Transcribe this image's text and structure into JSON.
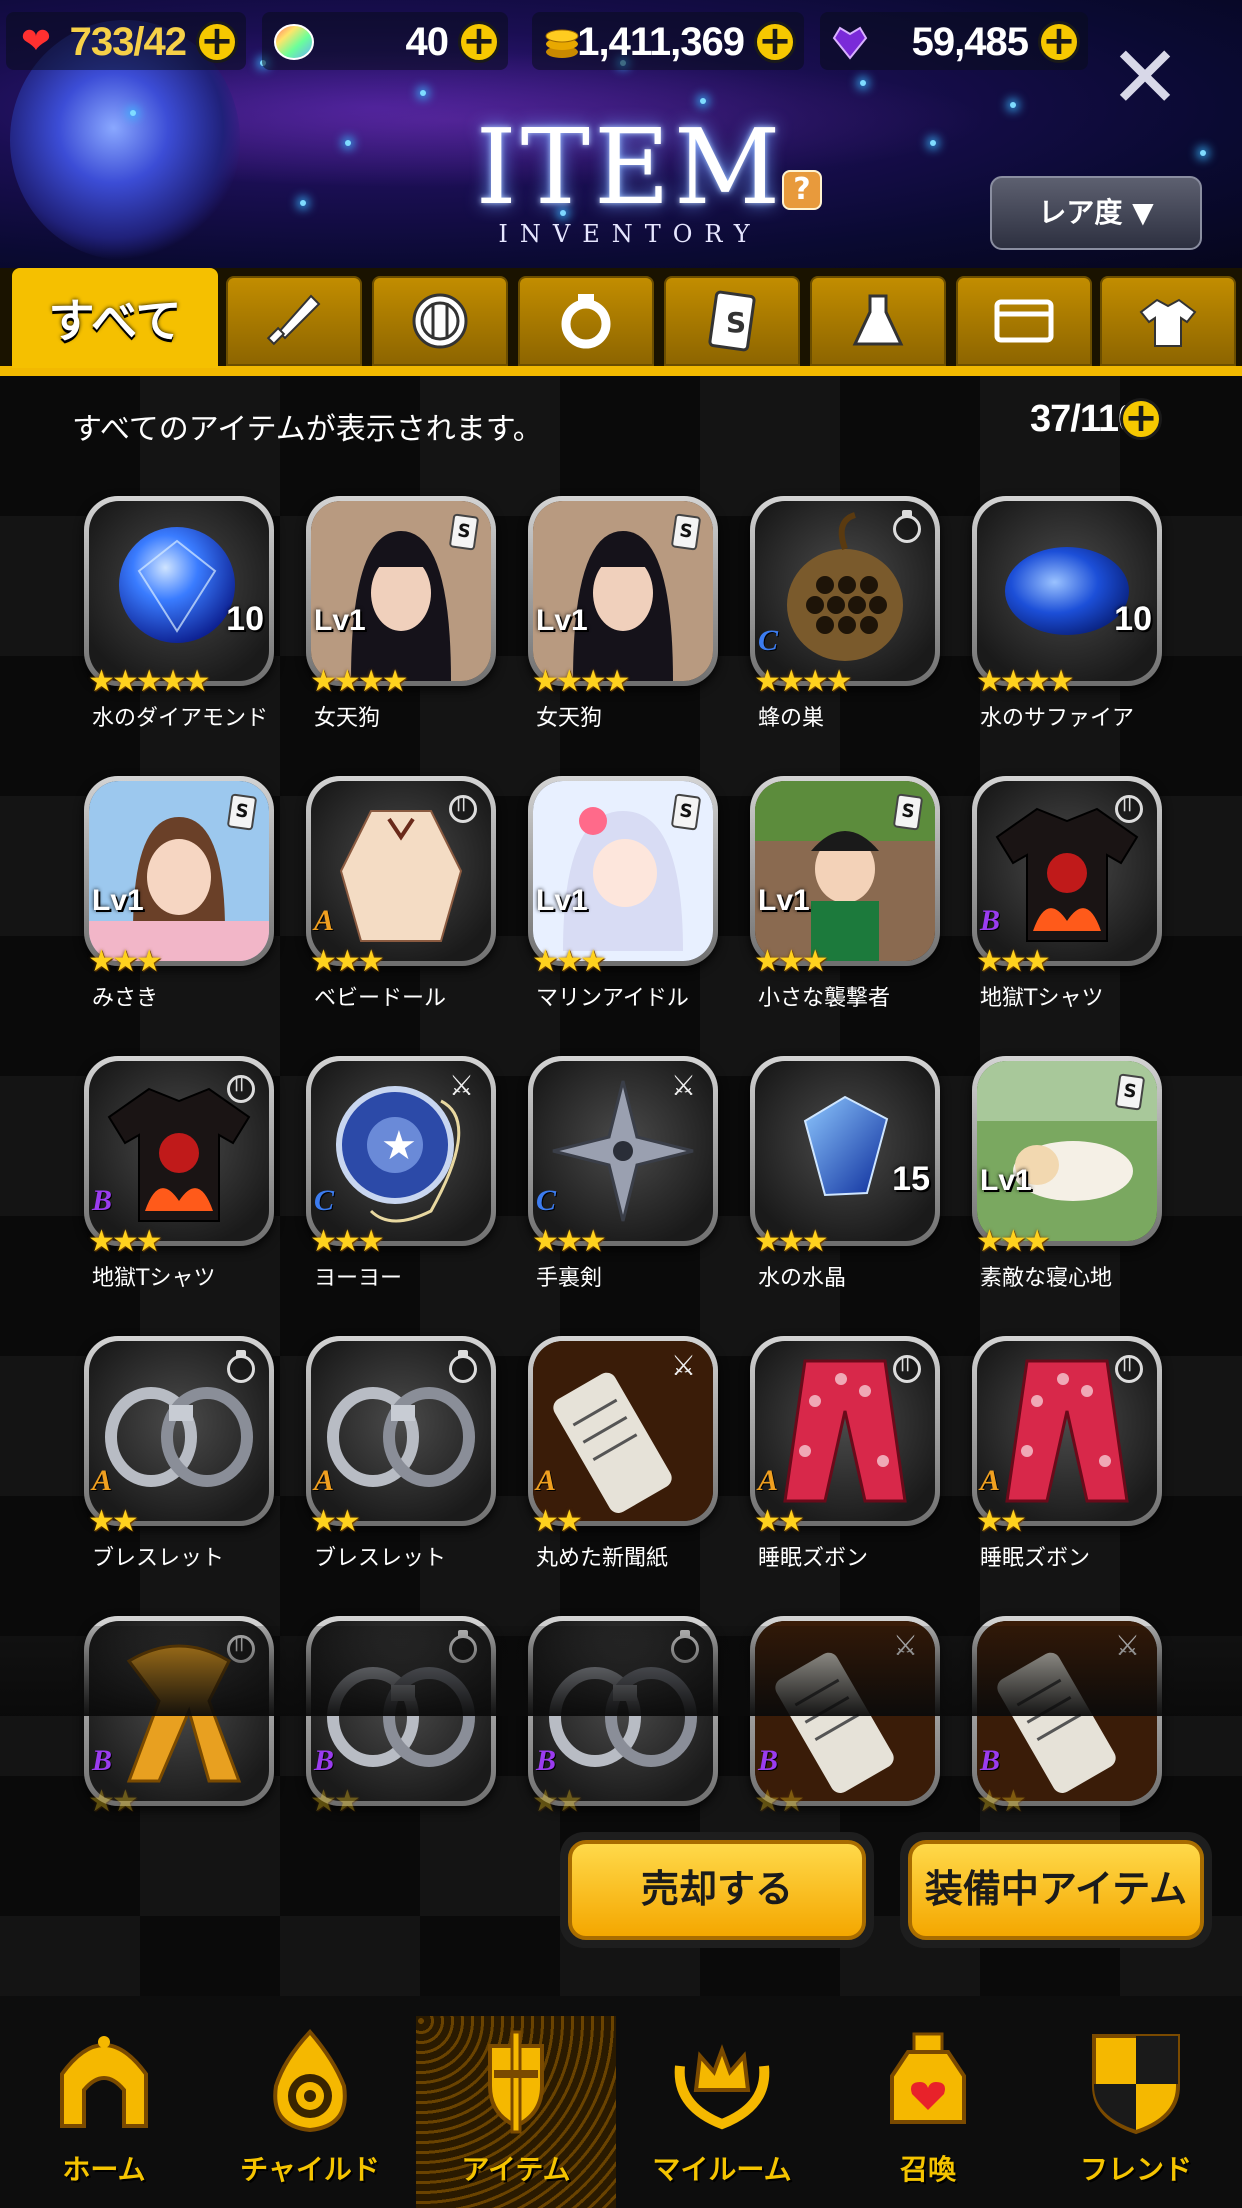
{
  "header": {
    "title": "ITEM",
    "subtitle": "INVENTORY",
    "help_label": "?",
    "sort_label": "レア度 ▼",
    "close_label": "✕",
    "resources": [
      {
        "name": "stamina",
        "icon": "heart-icon",
        "value": "733/42"
      },
      {
        "name": "gem-rainbow",
        "icon": "rainbow-gem-icon",
        "value": "40"
      },
      {
        "name": "gold",
        "icon": "gold-coin-icon",
        "value": "1,411,369"
      },
      {
        "name": "heart-gem",
        "icon": "purple-heart-gem-icon",
        "value": "59,485"
      }
    ]
  },
  "tabs": [
    {
      "label": "すべて",
      "icon": null
    },
    {
      "icon": "knife-icon"
    },
    {
      "icon": "shield-icon"
    },
    {
      "icon": "ring-icon"
    },
    {
      "icon": "card-icon"
    },
    {
      "icon": "flask-icon"
    },
    {
      "icon": "wallet-icon"
    },
    {
      "icon": "shirt-icon"
    }
  ],
  "content": {
    "info_text": "すべてのアイテムが表示されます。",
    "capacity": "37/110",
    "items": [
      {
        "name": "水のダイアモンド",
        "stars": "★★★★★",
        "stack": "10",
        "art": "blue-diamond",
        "badge": null,
        "lvl": null,
        "rank": null
      },
      {
        "name": "女天狗",
        "stars": "★★★★",
        "stack": null,
        "art": "portrait-dark",
        "badge": "card",
        "lvl": "Lv1",
        "rank": null
      },
      {
        "name": "女天狗",
        "stars": "★★★★",
        "stack": null,
        "art": "portrait-dark",
        "badge": "card",
        "lvl": "Lv1",
        "rank": null
      },
      {
        "name": "蜂の巣",
        "stars": "★★★★",
        "stack": null,
        "art": "beehive",
        "badge": "ring",
        "lvl": null,
        "rank": "C"
      },
      {
        "name": "水のサファイア",
        "stars": "★★★★",
        "stack": "10",
        "art": "sapphire",
        "badge": null,
        "lvl": null,
        "rank": null
      },
      {
        "name": "みさき",
        "stars": "★★★",
        "stack": null,
        "art": "portrait-light",
        "badge": "card",
        "lvl": "Lv1",
        "rank": null
      },
      {
        "name": "ベビードール",
        "stars": "★★★",
        "stack": null,
        "art": "babydoll",
        "badge": "cloth",
        "lvl": null,
        "rank": "A"
      },
      {
        "name": "マリンアイドル",
        "stars": "★★★",
        "stack": null,
        "art": "anime-idol",
        "badge": "card",
        "lvl": "Lv1",
        "rank": null
      },
      {
        "name": "小さな襲撃者",
        "stars": "★★★",
        "stack": null,
        "art": "boy-raider",
        "badge": "card",
        "lvl": "Lv1",
        "rank": null
      },
      {
        "name": "地獄Tシャツ",
        "stars": "★★★",
        "stack": null,
        "art": "hell-shirt",
        "badge": "cloth",
        "lvl": null,
        "rank": "B"
      },
      {
        "name": "地獄Tシャツ",
        "stars": "★★★",
        "stack": null,
        "art": "hell-shirt",
        "badge": "cloth",
        "lvl": null,
        "rank": "B"
      },
      {
        "name": "ヨーヨー",
        "stars": "★★★",
        "stack": null,
        "art": "yoyo",
        "badge": "knife",
        "lvl": null,
        "rank": "C"
      },
      {
        "name": "手裏剣",
        "stars": "★★★",
        "stack": null,
        "art": "shuriken",
        "badge": "knife",
        "lvl": null,
        "rank": "C"
      },
      {
        "name": "水の水晶",
        "stars": "★★★",
        "stack": "15",
        "art": "crystal",
        "badge": null,
        "lvl": null,
        "rank": null
      },
      {
        "name": "素敵な寝心地",
        "stars": "★★★",
        "stack": null,
        "art": "sleeping",
        "badge": "card",
        "lvl": "Lv1",
        "rank": null
      },
      {
        "name": "ブレスレット",
        "stars": "★★",
        "stack": null,
        "art": "cuffs",
        "badge": "ring",
        "lvl": null,
        "rank": "A"
      },
      {
        "name": "ブレスレット",
        "stars": "★★",
        "stack": null,
        "art": "cuffs",
        "badge": "ring",
        "lvl": null,
        "rank": "A"
      },
      {
        "name": "丸めた新聞紙",
        "stars": "★★",
        "stack": null,
        "art": "newspaper",
        "badge": "knife",
        "lvl": null,
        "rank": "A"
      },
      {
        "name": "睡眠ズボン",
        "stars": "★★",
        "stack": null,
        "art": "pants",
        "badge": "cloth",
        "lvl": null,
        "rank": "A"
      },
      {
        "name": "睡眠ズボン",
        "stars": "★★",
        "stack": null,
        "art": "pants",
        "badge": "cloth",
        "lvl": null,
        "rank": "A"
      },
      {
        "name": "",
        "stars": "★★",
        "stack": null,
        "art": "scarf",
        "badge": "cloth",
        "lvl": null,
        "rank": "B"
      },
      {
        "name": "",
        "stars": "★★",
        "stack": null,
        "art": "cuffs",
        "badge": "ring",
        "lvl": null,
        "rank": "B"
      },
      {
        "name": "",
        "stars": "★★",
        "stack": null,
        "art": "cuffs",
        "badge": "ring",
        "lvl": null,
        "rank": "B"
      },
      {
        "name": "",
        "stars": "★★",
        "stack": null,
        "art": "newspaper",
        "badge": "knife",
        "lvl": null,
        "rank": "B"
      },
      {
        "name": "",
        "stars": "★★",
        "stack": null,
        "art": "newspaper",
        "badge": "knife",
        "lvl": null,
        "rank": "B"
      }
    ],
    "sell_label": "売却する",
    "equipped_label": "装備中アイテム"
  },
  "nav": [
    {
      "label": "ホーム",
      "icon": "home-arch-icon"
    },
    {
      "label": "チャイルド",
      "icon": "child-flame-icon"
    },
    {
      "label": "アイテム",
      "icon": "knight-helmet-icon"
    },
    {
      "label": "マイルーム",
      "icon": "crown-laurel-icon"
    },
    {
      "label": "召喚",
      "icon": "summon-bottle-icon"
    },
    {
      "label": "フレンド",
      "icon": "friend-shield-icon"
    }
  ],
  "colors": {
    "accent_gold": "#f5c000",
    "rank_A": "#f0a020",
    "rank_B": "#9b3cf0",
    "rank_C": "#3c7cf0"
  }
}
